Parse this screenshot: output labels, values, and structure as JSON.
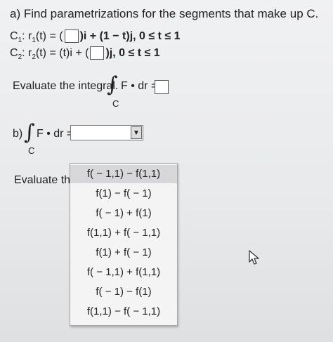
{
  "question": {
    "part_a_heading": "a) Find parametrizations for the segments that make up C.",
    "c1": {
      "label": "C",
      "sub": "1",
      "r": "r",
      "r_sub": "1",
      "middle": "(t) = (",
      "after_box": ")i + (1 − t)j, 0 ≤ t ≤ 1"
    },
    "c2": {
      "label": "C",
      "sub": "2",
      "r": "r",
      "r_sub": "2",
      "middle": "(t) = (t)i + (",
      "after_box": ")j, 0 ≤ t ≤ 1"
    },
    "evaluate_text": "Evaluate the integral.",
    "integral_symbol": "∫",
    "integral_subscript": "C",
    "f_dot_dr": "F • dr =",
    "part_b_label": "b)",
    "evaluate_text_2": "Evaluate the"
  },
  "select": {
    "arrow": "▼",
    "options": [
      "f( − 1,1) − f(1,1)",
      "f(1) − f( − 1)",
      "f( − 1) + f(1)",
      "f(1,1) + f( − 1,1)",
      "f(1) + f( − 1)",
      "f( − 1,1) + f(1,1)",
      "f( − 1) − f(1)",
      "f(1,1) − f( − 1,1)"
    ],
    "highlighted_index": 0
  },
  "icons": {
    "cursor": "mouse-pointer-icon"
  }
}
